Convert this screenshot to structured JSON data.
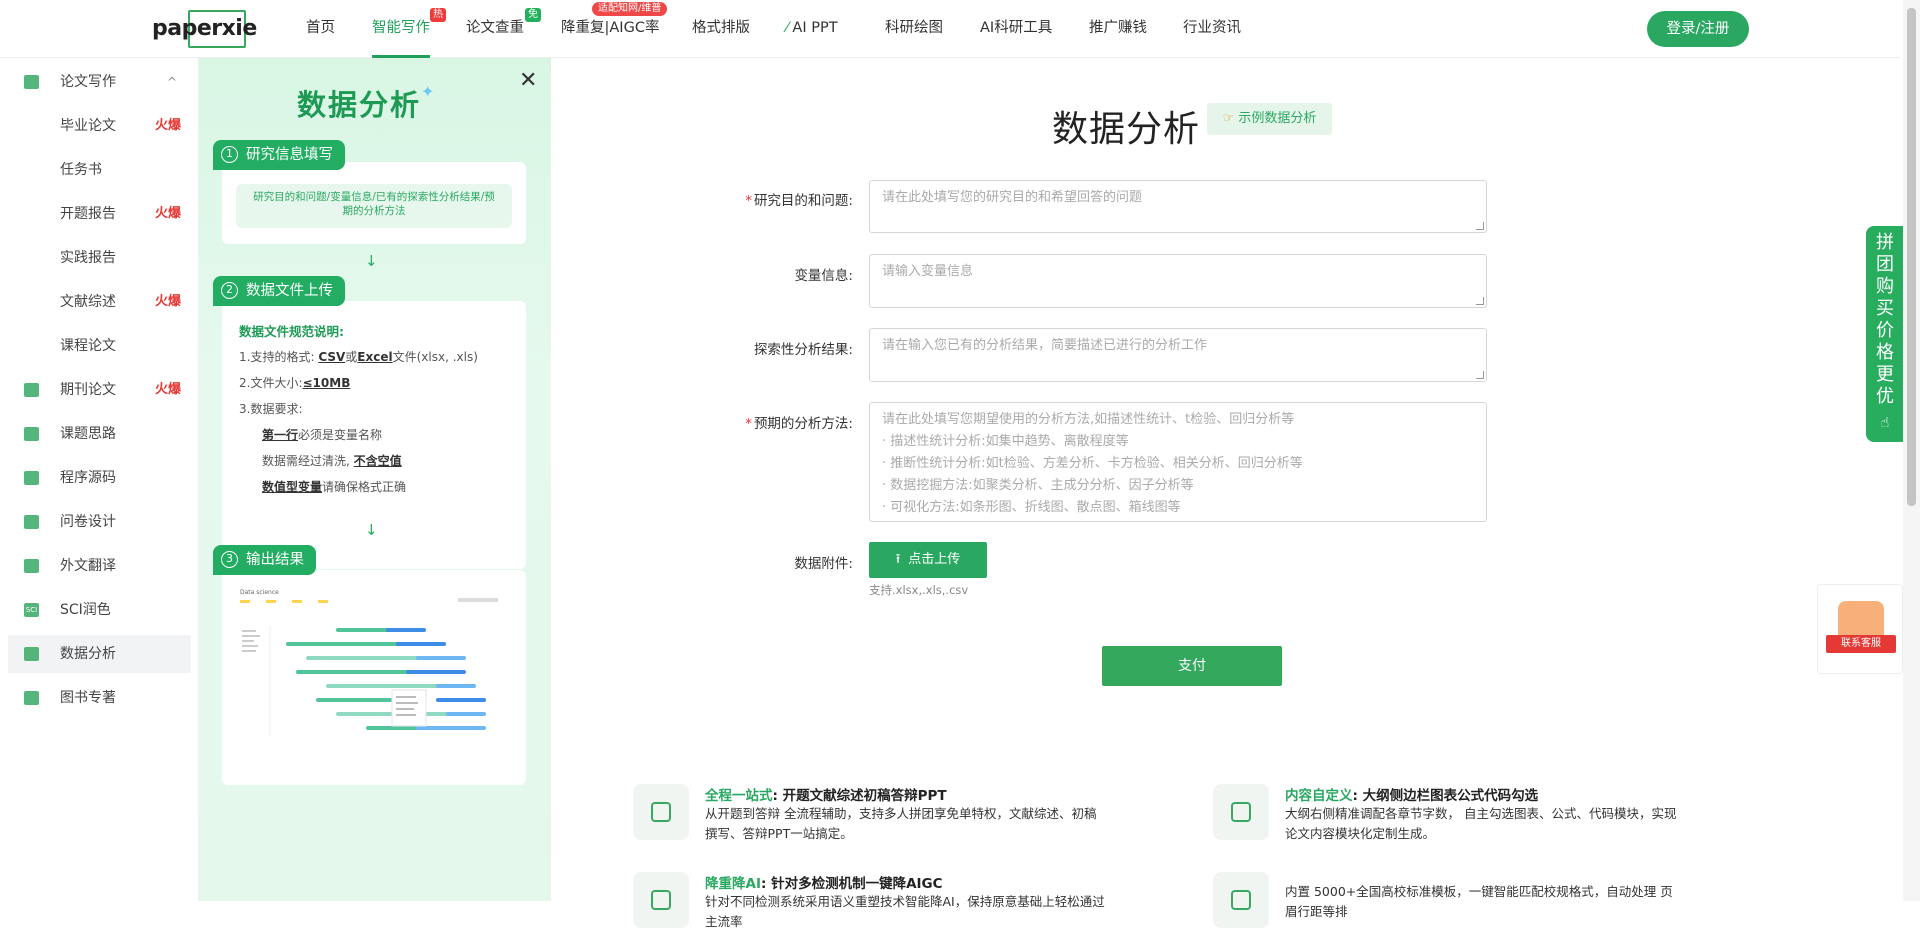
{
  "nav": {
    "logo": "paperxie",
    "items": [
      "首页",
      "智能写作",
      "论文查重",
      "降重复|AIGC率",
      "格式排版",
      "AI PPT",
      "科研绘图",
      "AI科研工具",
      "推广赚钱",
      "行业资讯"
    ],
    "badges": {
      "hot": "热",
      "free": "免",
      "cnki": "适配知网/维普"
    },
    "login": "登录/注册"
  },
  "sidebar": {
    "items": [
      {
        "label": "论文写作",
        "chevron": "^"
      },
      {
        "label": "毕业论文",
        "fire": "火爆"
      },
      {
        "label": "任务书"
      },
      {
        "label": "开题报告",
        "fire": "火爆"
      },
      {
        "label": "实践报告"
      },
      {
        "label": "文献综述",
        "fire": "火爆"
      },
      {
        "label": "课程论文"
      },
      {
        "label": "期刊论文",
        "fire": "火爆"
      },
      {
        "label": "课题思路"
      },
      {
        "label": "程序源码"
      },
      {
        "label": "问卷设计"
      },
      {
        "label": "外文翻译"
      },
      {
        "label": "SCI润色"
      },
      {
        "label": "数据分析"
      },
      {
        "label": "图书专著"
      }
    ],
    "sci_icon": "SCI"
  },
  "guide": {
    "title": "数据分析",
    "close": "✕",
    "step1": {
      "num": "1",
      "title": "研究信息填写",
      "text": "研究目的和问题/变量信息/已有的探索性分析结果/预期的分析方法"
    },
    "step2": {
      "num": "2",
      "title": "数据文件上传",
      "heading": "数据文件规范说明:",
      "l1_a": "1.支持的格式: ",
      "l1_csv": "CSV",
      "l1_or": "或",
      "l1_excel": "Excel",
      "l1_b": "文件(xlsx, .xls)",
      "l2_a": "2.文件大小:",
      "l2_b": "≤10MB",
      "l3": "3.数据要求:",
      "l4_a": "第一行",
      "l4_b": "必须是变量名称",
      "l5_a": "数据需经过清洗, ",
      "l5_b": "不含空值",
      "l6_a": "数值型变量",
      "l6_b": "请确保格式正确"
    },
    "step3": {
      "num": "3",
      "title": "输出结果",
      "chart_caption": "Data science"
    },
    "arrow": "↓"
  },
  "form": {
    "title": "数据分析",
    "example": "示例数据分析",
    "fields": [
      {
        "label": "研究目的和问题:",
        "required": true,
        "placeholder": "请在此处填写您的研究目的和希望回答的问题"
      },
      {
        "label": "变量信息:",
        "required": false,
        "placeholder": "请输入变量信息"
      },
      {
        "label": "探索性分析结果:",
        "required": false,
        "placeholder": "请在输入您已有的分析结果，简要描述已进行的分析工作"
      },
      {
        "label": "预期的分析方法:",
        "required": true,
        "placeholder": "请在此处填写您期望使用的分析方法,如描述性统计、t检验、回归分析等"
      }
    ],
    "method_hints": [
      "· 描述性统计分析:如集中趋势、离散程度等",
      "· 推断性统计分析:如t检验、方差分析、卡方检验、相关分析、回归分析等",
      "· 数据挖掘方法:如聚类分析、主成分分析、因子分析等",
      "· 可视化方法:如条形图、折线图、散点图、箱线图等"
    ],
    "attachment_label": "数据附件:",
    "upload": "点击上传",
    "upload_hint": "支持.xlsx,.xls,.csv",
    "pay": "支付"
  },
  "features": [
    {
      "title_g": "全程一站式",
      "title": ": 开题文献综述初稿答辩PPT",
      "desc": "从开题到答辩 全流程辅助，支持多人拼团享免单特权，文献综述、初稿撰写、答辩PPT一站搞定。"
    },
    {
      "title_g": "内容自定义",
      "title": ": 大纲侧边栏图表公式代码勾选",
      "desc": "大纲右侧精准调配各章节字数， 自主勾选图表、公式、代码模块，实现论文内容模块化定制生成。"
    },
    {
      "title_g": "降重降AI",
      "title": ": 针对多检测机制一键降AIGC",
      "desc": "针对不同检测系统采用语义重塑技术智能降AI，保持原意基础上轻松通过主流率"
    },
    {
      "title_g": "",
      "title": "",
      "desc": "内置 5000+全国高校标准模板，一键智能匹配校规格式，自动处理 页眉行距等排"
    }
  ],
  "promo": {
    "text": "拼团购买 价格更优"
  },
  "service": {
    "text": "联系客服"
  }
}
